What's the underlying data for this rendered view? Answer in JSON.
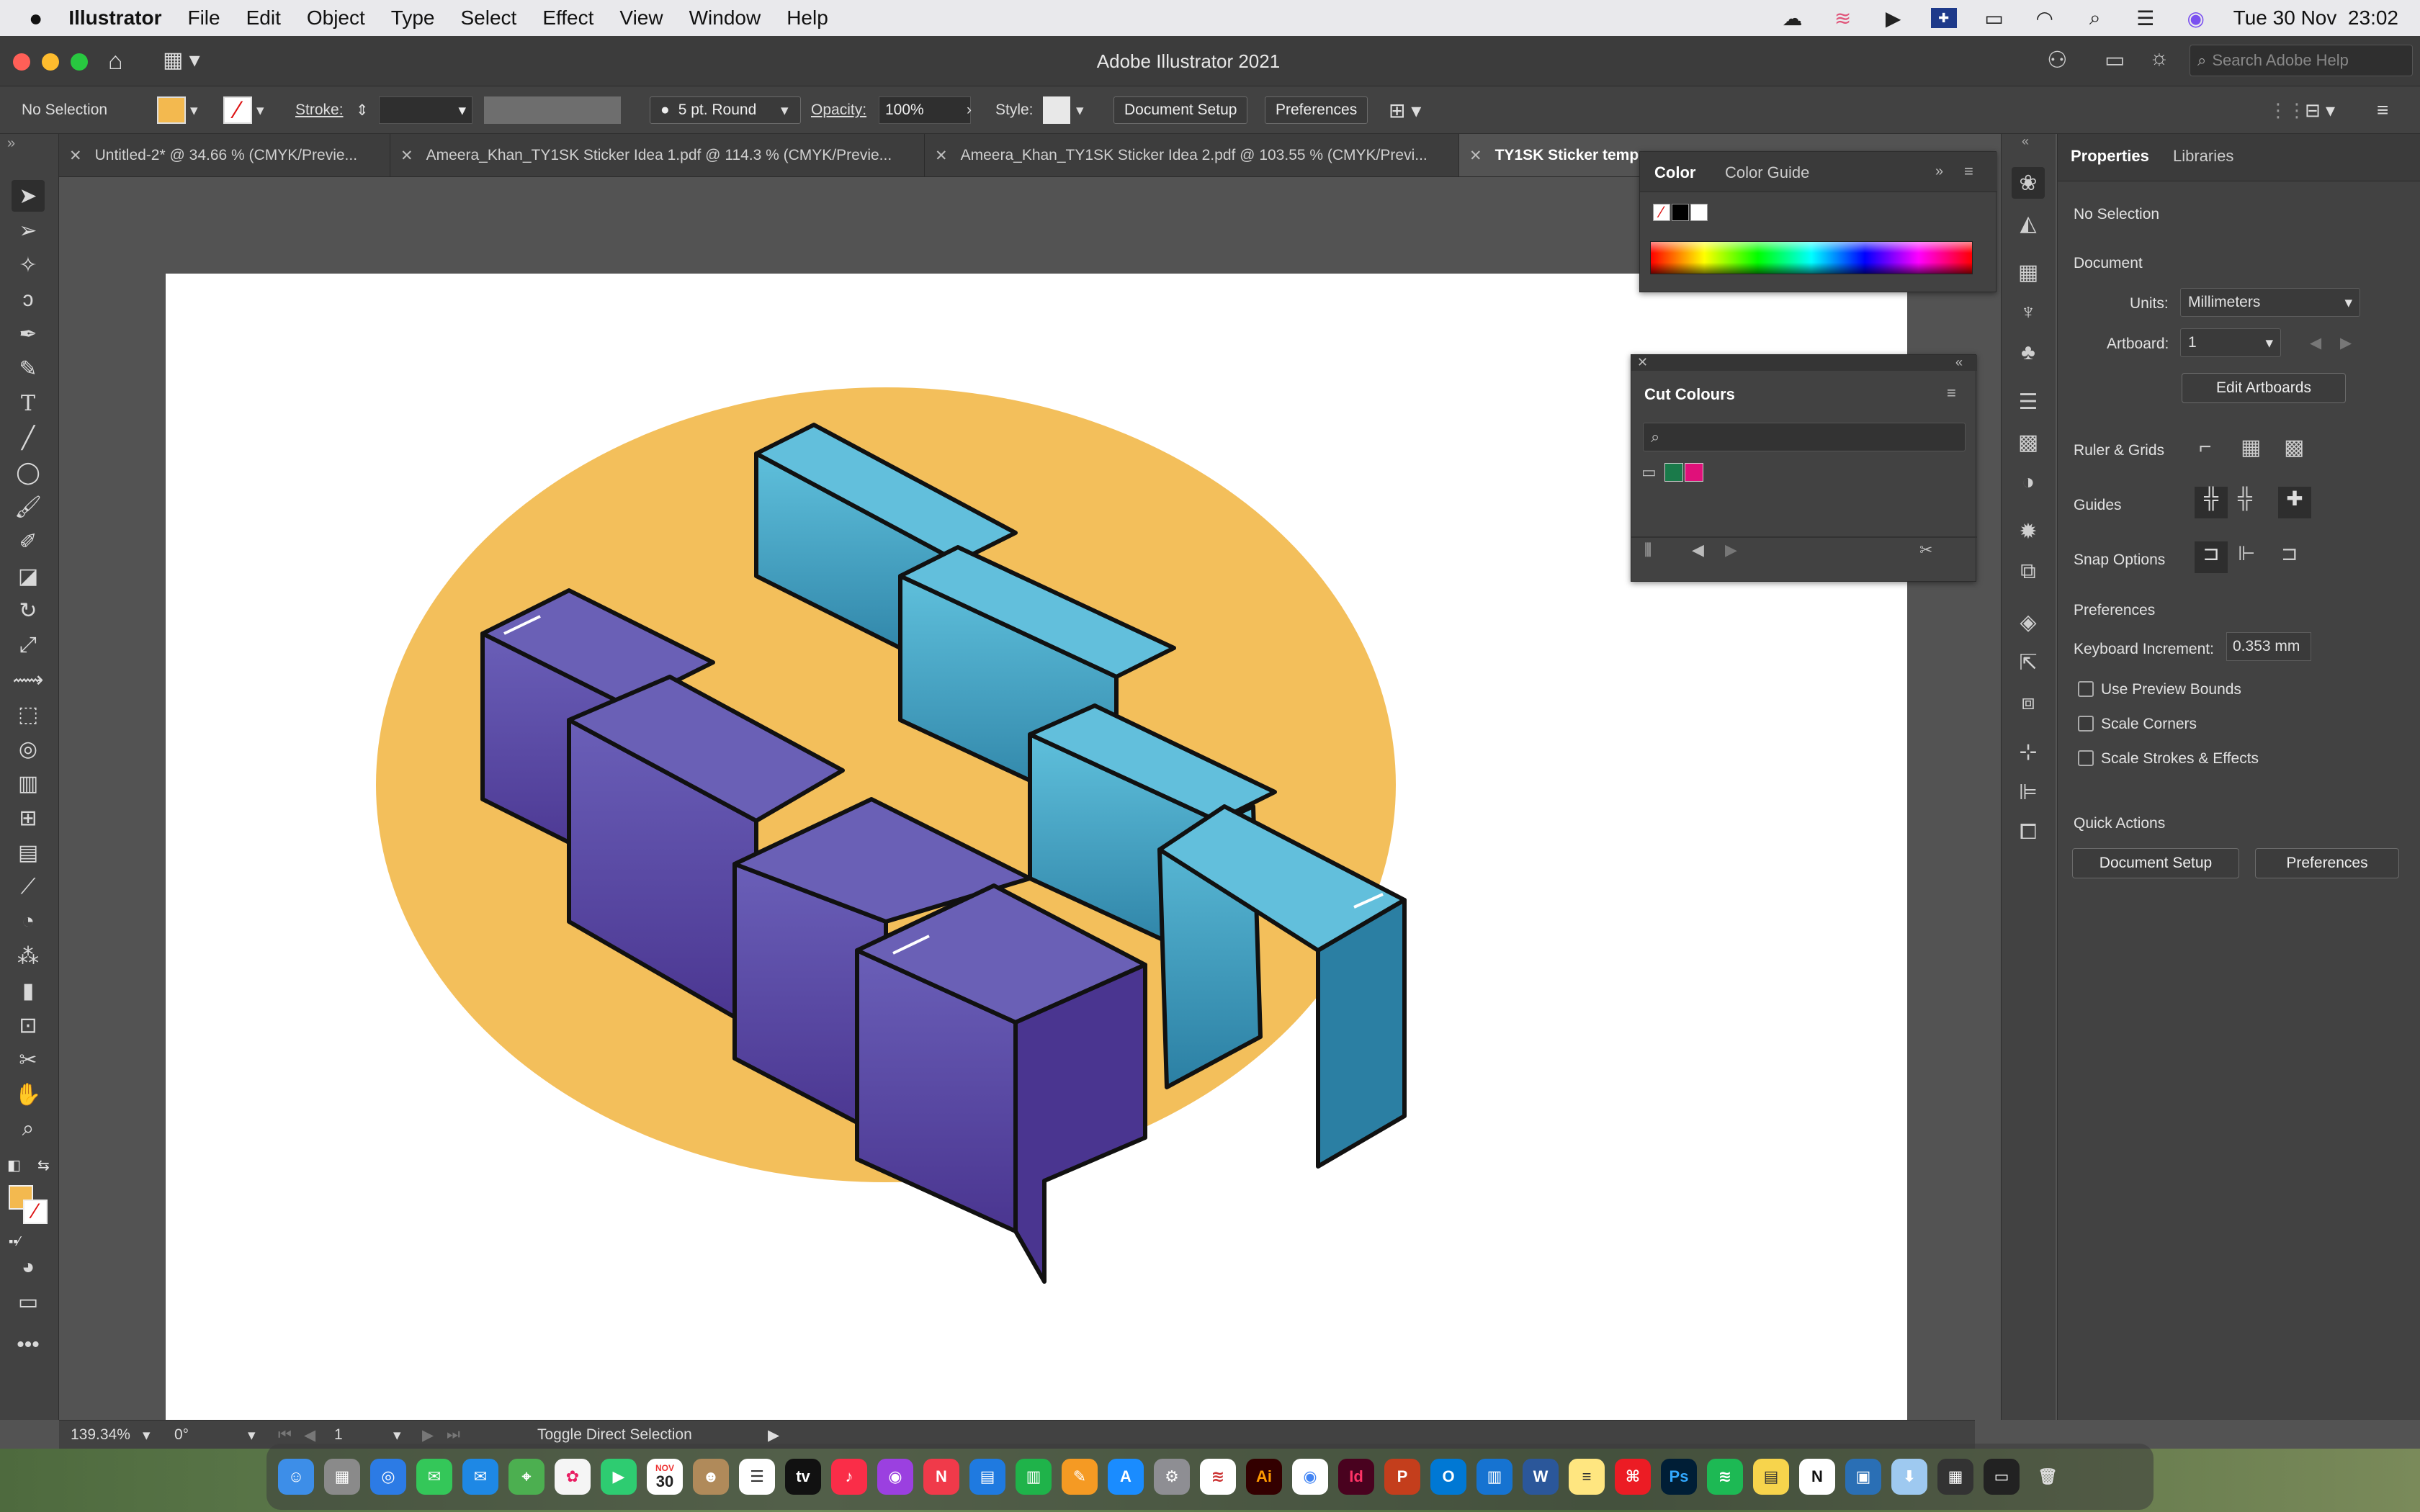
{
  "menubar": {
    "apple": "",
    "app": "Illustrator",
    "items": [
      "File",
      "Edit",
      "Object",
      "Type",
      "Select",
      "Effect",
      "View",
      "Window",
      "Help"
    ],
    "clock": "Tue 30 Nov  23:02"
  },
  "window": {
    "title": "Adobe Illustrator 2021",
    "search_placeholder": "Search Adobe Help"
  },
  "control_bar": {
    "selection": "No Selection",
    "stroke_label": "Stroke:",
    "brush": "5 pt. Round",
    "opacity_label": "Opacity:",
    "opacity_value": "100%",
    "style_label": "Style:",
    "document_setup": "Document Setup",
    "preferences": "Preferences",
    "fill_color": "#f3b94f"
  },
  "tabs": [
    {
      "label": "Untitled-2* @ 34.66 % (CMYK/Previe..."
    },
    {
      "label": "Ameera_Khan_TY1SK Sticker Idea 1.pdf @ 114.3 % (CMYK/Previe..."
    },
    {
      "label": "Ameera_Khan_TY1SK Sticker Idea 2.pdf @ 103.55 % (CMYK/Previ..."
    },
    {
      "label": "TY1SK Sticker temp"
    }
  ],
  "color_panel": {
    "tab_color": "Color",
    "tab_guide": "Color Guide"
  },
  "cut_panel": {
    "title": "Cut Colours",
    "search_placeholder": ""
  },
  "properties": {
    "tab_properties": "Properties",
    "tab_libraries": "Libraries",
    "no_selection": "No Selection",
    "document": "Document",
    "units_label": "Units:",
    "units_value": "Millimeters",
    "artboard_label": "Artboard:",
    "artboard_value": "1",
    "edit_artboards": "Edit Artboards",
    "ruler_grids": "Ruler & Grids",
    "guides": "Guides",
    "snap_options": "Snap Options",
    "preferences": "Preferences",
    "keyboard_increment_label": "Keyboard Increment:",
    "keyboard_increment_value": "0.353 mm",
    "use_preview_bounds": "Use Preview Bounds",
    "scale_corners": "Scale Corners",
    "scale_strokes": "Scale Strokes & Effects",
    "quick_actions": "Quick Actions",
    "document_setup": "Document Setup",
    "preferences_btn": "Preferences"
  },
  "status": {
    "zoom": "139.34%",
    "rotation": "0°",
    "artboard": "1",
    "tool_hint": "Toggle Direct Selection"
  },
  "artwork": {
    "background_color": "#f3bf5b",
    "purple_color": "#5a4ea3",
    "blue_color": "#4fb0cf",
    "letters_back": [
      "T",
      "Y",
      "P",
      "E"
    ],
    "letters_front": [
      "T",
      "A",
      "L",
      "K"
    ]
  },
  "dock": {
    "calendar_month": "NOV",
    "calendar_day": "30",
    "apps": [
      "Finder",
      "Launchpad",
      "Safari",
      "Messages",
      "Mail",
      "Maps",
      "Photos",
      "FaceTime",
      "Calendar",
      "Contacts",
      "Reminders",
      "TV",
      "Music",
      "Podcasts",
      "News",
      "Keynote",
      "Numbers",
      "Pages",
      "App Store",
      "System Preferences",
      "Illustrator",
      "Chrome",
      "InDesign",
      "PowerPoint",
      "Outlook",
      "Word",
      "Acrobat",
      "Photoshop",
      "Spotify",
      "Notes",
      "Notion",
      "Trash"
    ]
  }
}
